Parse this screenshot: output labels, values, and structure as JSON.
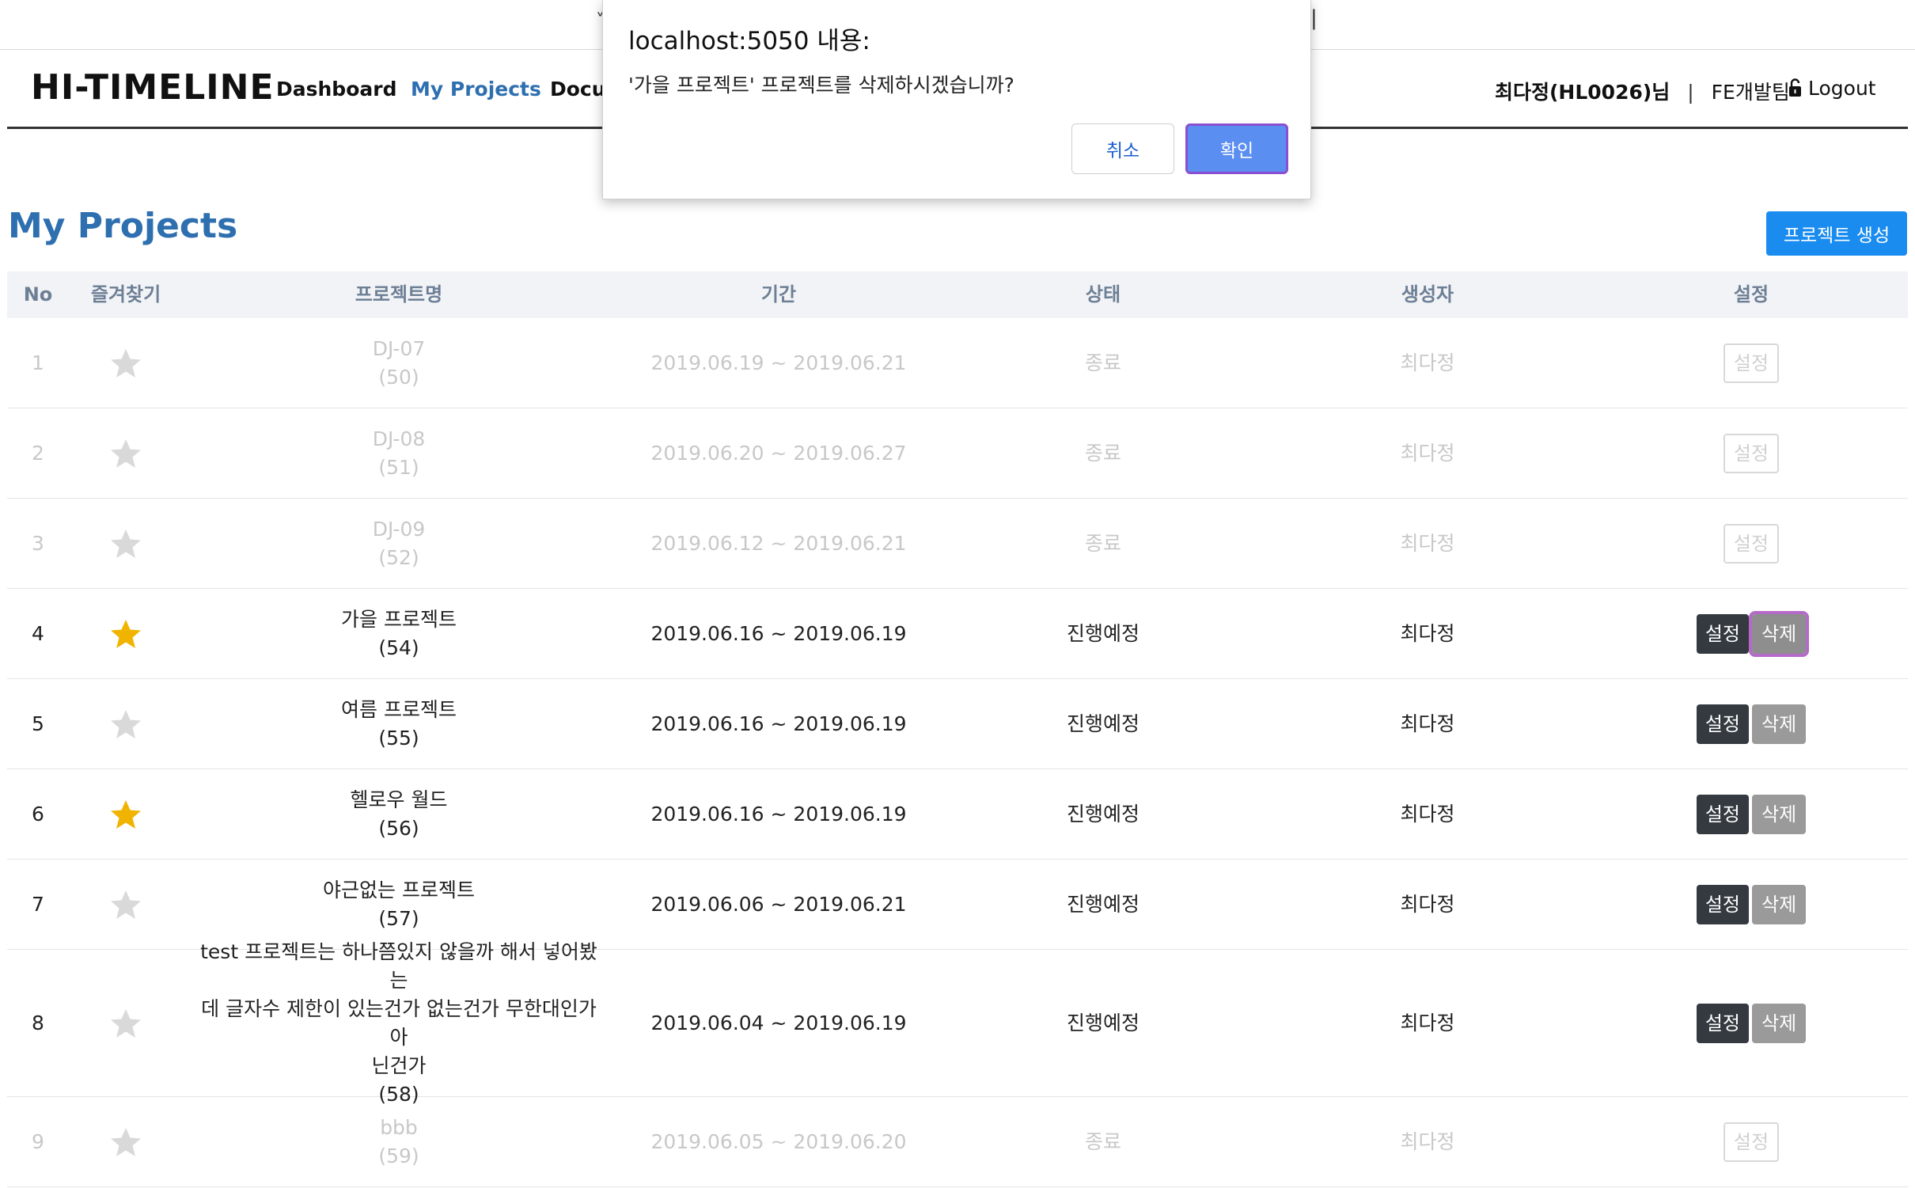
{
  "browser": {
    "partial_text_left": "˅",
    "partial_text_right": "|"
  },
  "nav": {
    "brand": "HI-TIMELINE",
    "links": [
      "Dashboard",
      "My Projects",
      "Docu"
    ],
    "active_index": 1,
    "user": "최다정(HL0026)님",
    "separator": "|",
    "team": "FE개발팀",
    "logout": "Logout"
  },
  "page": {
    "title": "My Projects",
    "create_button": "프로젝트 생성"
  },
  "table": {
    "headers": [
      "No",
      "즐겨찾기",
      "프로젝트명",
      "기간",
      "상태",
      "생성자",
      "설정"
    ],
    "rows": [
      {
        "no": "1",
        "starred": false,
        "name": "DJ-07",
        "id": "(50)",
        "period": "2019.06.19 ~ 2019.06.21",
        "status": "종료",
        "creator": "최다정",
        "ended": true
      },
      {
        "no": "2",
        "starred": false,
        "name": "DJ-08",
        "id": "(51)",
        "period": "2019.06.20 ~ 2019.06.27",
        "status": "종료",
        "creator": "최다정",
        "ended": true
      },
      {
        "no": "3",
        "starred": false,
        "name": "DJ-09",
        "id": "(52)",
        "period": "2019.06.12 ~ 2019.06.21",
        "status": "종료",
        "creator": "최다정",
        "ended": true
      },
      {
        "no": "4",
        "starred": true,
        "name": "가을 프로젝트",
        "id": "(54)",
        "period": "2019.06.16 ~ 2019.06.19",
        "status": "진행예정",
        "creator": "최다정",
        "ended": false
      },
      {
        "no": "5",
        "starred": false,
        "name": "여름 프로젝트",
        "id": "(55)",
        "period": "2019.06.16 ~ 2019.06.19",
        "status": "진행예정",
        "creator": "최다정",
        "ended": false
      },
      {
        "no": "6",
        "starred": true,
        "name": "헬로우 월드",
        "id": "(56)",
        "period": "2019.06.16 ~ 2019.06.19",
        "status": "진행예정",
        "creator": "최다정",
        "ended": false
      },
      {
        "no": "7",
        "starred": false,
        "name": "야근없는 프로젝트",
        "id": "(57)",
        "period": "2019.06.06 ~ 2019.06.21",
        "status": "진행예정",
        "creator": "최다정",
        "ended": false
      },
      {
        "no": "8",
        "starred": false,
        "name_lines": [
          "test 프로젝트는 하나쯤있지 않을까 해서 넣어봤는",
          "데 글자수 제한이 있는건가 없는건가 무한대인가 아",
          "닌건가"
        ],
        "id": "(58)",
        "period": "2019.06.04 ~ 2019.06.19",
        "status": "진행예정",
        "creator": "최다정",
        "ended": false
      },
      {
        "no": "9",
        "starred": false,
        "name": "bbb",
        "id": "(59)",
        "period": "2019.06.05 ~ 2019.06.20",
        "status": "종료",
        "creator": "최다정",
        "ended": true
      }
    ],
    "settings_label": "설정",
    "delete_label": "삭제"
  },
  "dialog": {
    "title": "localhost:5050 내용:",
    "message": "'가을 프로젝트' 프로젝트를 삭제하시겠습니까?",
    "cancel": "취소",
    "ok": "확인"
  },
  "colors": {
    "accent": "#2e6fb0",
    "create_button": "#1a8cf0",
    "star_on": "#f0b400",
    "star_off": "#d9d9d9",
    "settings_button": "#343a40",
    "delete_button": "#9a9a9a",
    "dialog_ok": "#5a8ef0"
  }
}
